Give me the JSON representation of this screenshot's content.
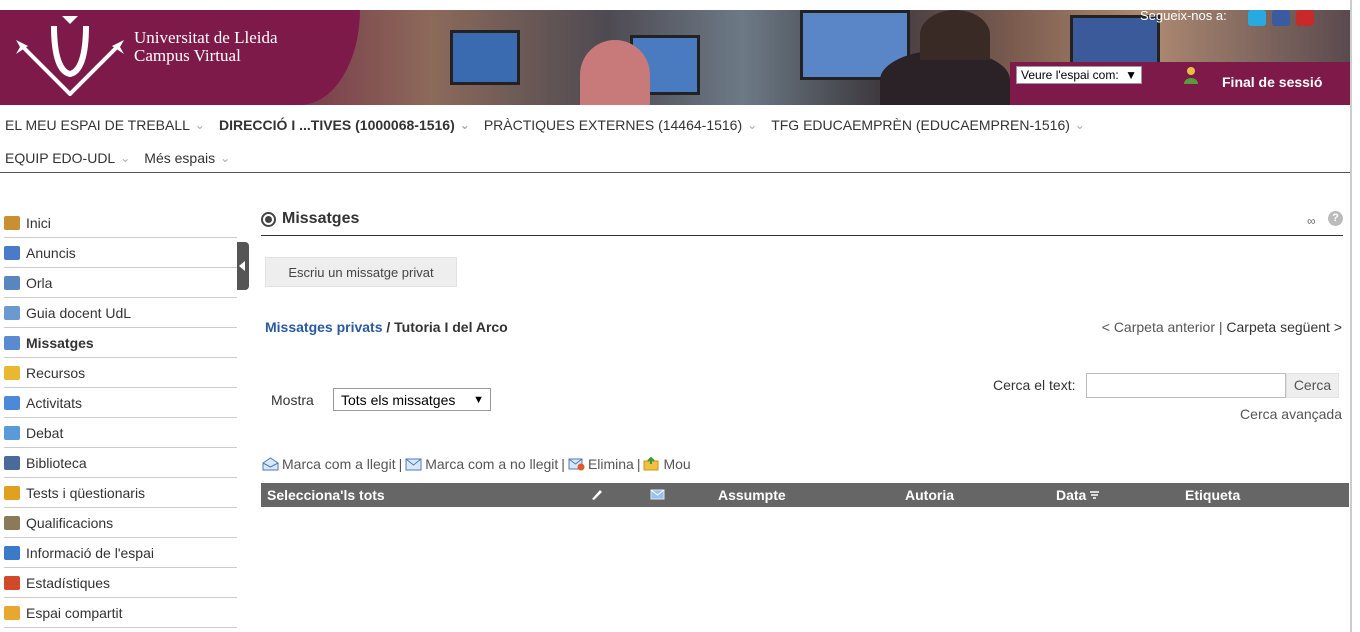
{
  "header": {
    "university_line1": "Universitat de Lleida",
    "university_line2": "Campus Virtual",
    "follow_label": "Segueix-nos a:",
    "view_as_label": "Veure l'espai com:",
    "view_as_arrow": "▼",
    "logout_label": "Final de sessió"
  },
  "nav": {
    "row1": [
      {
        "label": "EL MEU ESPAI DE TREBALL",
        "active": false
      },
      {
        "label": "DIRECCIÓ I ...TIVES (1000068-1516)",
        "active": true
      },
      {
        "label": "PRÀCTIQUES EXTERNES (14464-1516)",
        "active": false
      },
      {
        "label": "TFG EDUCAEMPRÈN (EDUCAEMPREN-1516)",
        "active": false
      }
    ],
    "row2": [
      {
        "label": "EQUIP EDO-UDL",
        "active": false
      },
      {
        "label": "Més espais",
        "active": false
      }
    ],
    "chevron": "⌄"
  },
  "sidebar": {
    "items": [
      {
        "label": "Inici",
        "icon": "home-icon",
        "color": "#c89030",
        "active": false
      },
      {
        "label": "Anuncis",
        "icon": "announcements-icon",
        "color": "#4a7ac8",
        "active": false
      },
      {
        "label": "Orla",
        "icon": "orla-icon",
        "color": "#5a86c0",
        "active": false
      },
      {
        "label": "Guia docent UdL",
        "icon": "guide-icon",
        "color": "#6a9ad0",
        "active": false
      },
      {
        "label": "Missatges",
        "icon": "messages-icon",
        "color": "#5a8ad0",
        "active": true
      },
      {
        "label": "Recursos",
        "icon": "folder-icon",
        "color": "#e8b830",
        "active": false
      },
      {
        "label": "Activitats",
        "icon": "activities-icon",
        "color": "#4a8ad8",
        "active": false
      },
      {
        "label": "Debat",
        "icon": "debate-icon",
        "color": "#5a9ad8",
        "active": false
      },
      {
        "label": "Biblioteca",
        "icon": "library-icon",
        "color": "#4a6a9a",
        "active": false
      },
      {
        "label": "Tests i qüestionaris",
        "icon": "pencil-icon",
        "color": "#e0a020",
        "active": false
      },
      {
        "label": "Qualificacions",
        "icon": "grades-icon",
        "color": "#8a7a5a",
        "active": false
      },
      {
        "label": "Informació de l'espai",
        "icon": "info-icon",
        "color": "#3a7ac8",
        "active": false
      },
      {
        "label": "Estadístiques",
        "icon": "stats-icon",
        "color": "#d04a2a",
        "active": false
      },
      {
        "label": "Espai compartit",
        "icon": "shared-space-icon",
        "color": "#e8a830",
        "active": false
      }
    ]
  },
  "main": {
    "title": "Missatges",
    "help": "?",
    "link_glyph": "∞",
    "compose_button": "Escriu un missatge privat",
    "breadcrumb_link": "Missatges privats",
    "breadcrumb_sep": " / ",
    "breadcrumb_current": "Tutoria I del Arco",
    "prev_folder": "< Carpeta anterior",
    "folder_sep": " | ",
    "next_folder": "Carpeta següent >",
    "show_label": "Mostra",
    "show_value": "Tots els missatges",
    "show_arrow": "▼",
    "search_label": "Cerca el text:",
    "search_value": "",
    "search_button": "Cerca",
    "advanced_search": "Cerca avançada",
    "actions": {
      "mark_read": "Marca com a llegit",
      "mark_unread": "Marca com a no llegit",
      "delete": "Elimina",
      "move": "Mou",
      "separator": "|"
    },
    "table": {
      "select_all": "Selecciona'ls tots",
      "subject": "Assumpte",
      "author": "Autoria",
      "date": "Data",
      "tag": "Etiqueta"
    }
  }
}
